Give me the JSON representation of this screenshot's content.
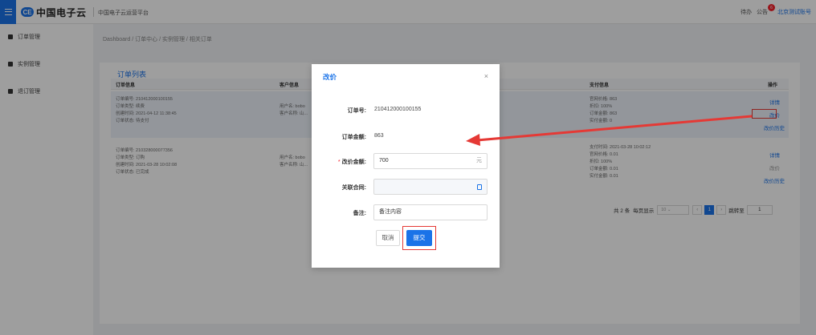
{
  "topbar": {
    "logo_mark": "CE",
    "logo_text": "中国电子云",
    "platform_title": "中国电子云运营平台",
    "todo": "待办",
    "notice": "公告",
    "notice_count": "6",
    "account": "北京测试账号"
  },
  "sidebar": {
    "items": [
      {
        "label": "订单管理"
      },
      {
        "label": "实例管理"
      },
      {
        "label": "退订管理"
      }
    ]
  },
  "breadcrumb": {
    "items": [
      "Dashboard",
      "订单中心",
      "实例管理",
      "相关订单"
    ],
    "separator": "/"
  },
  "list": {
    "title": "订单列表",
    "columns": [
      "订单信息",
      "客户信息",
      "支付信息",
      "操作"
    ],
    "rows": [
      {
        "order_lines": [
          "订单编号: 210412000100155",
          "订单类型: 续费",
          "创建时间: 2021-04-12 11:38:45",
          "订单状态: 待支付"
        ],
        "customer_lines": [
          "用户名: bobo",
          "客户名称: 山..."
        ],
        "payment_lines": [
          "官网价格: 863",
          "折扣: 100%",
          "订单金额: 863",
          "实付金额: 0"
        ],
        "actions": [
          "详情",
          "改价",
          "改价历史"
        ]
      },
      {
        "order_lines": [
          "订单编号: 210328000077356",
          "订单类型: 订购",
          "创建时间: 2021-03-28 10:02:08",
          "订单状态: 已完成"
        ],
        "customer_lines": [
          "用户名: bobo",
          "客户名称: 山..."
        ],
        "payment_lines": [
          "支付时间: 2021-03-28 10:02:12",
          "官网价格: 0.01",
          "折扣: 100%",
          "订单金额: 0.01",
          "实付金额: 0.01"
        ],
        "actions": [
          "详情",
          "改价",
          "改价历史"
        ]
      }
    ],
    "pagination": {
      "total": "共 2 条",
      "per_page_label": "每页显示",
      "per_page_value": "10",
      "current_page": "1",
      "jump_label": "跳转至",
      "jump_value": "1"
    }
  },
  "modal": {
    "title": "改价",
    "close": "×",
    "order_no_label": "订单号:",
    "order_no_value": "210412000100155",
    "amount_label": "订单金额:",
    "amount_value": "863",
    "new_price_label": "改价金额:",
    "new_price_value": "700",
    "new_price_unit": "元",
    "contract_label": "关联合同:",
    "contract_value": "",
    "remark_label": "备注:",
    "remark_value": "备注内容",
    "cancel_label": "取消",
    "submit_label": "提交"
  },
  "colors": {
    "primary": "#1a73e8",
    "highlight": "#e53935",
    "danger": "#f5222d"
  }
}
